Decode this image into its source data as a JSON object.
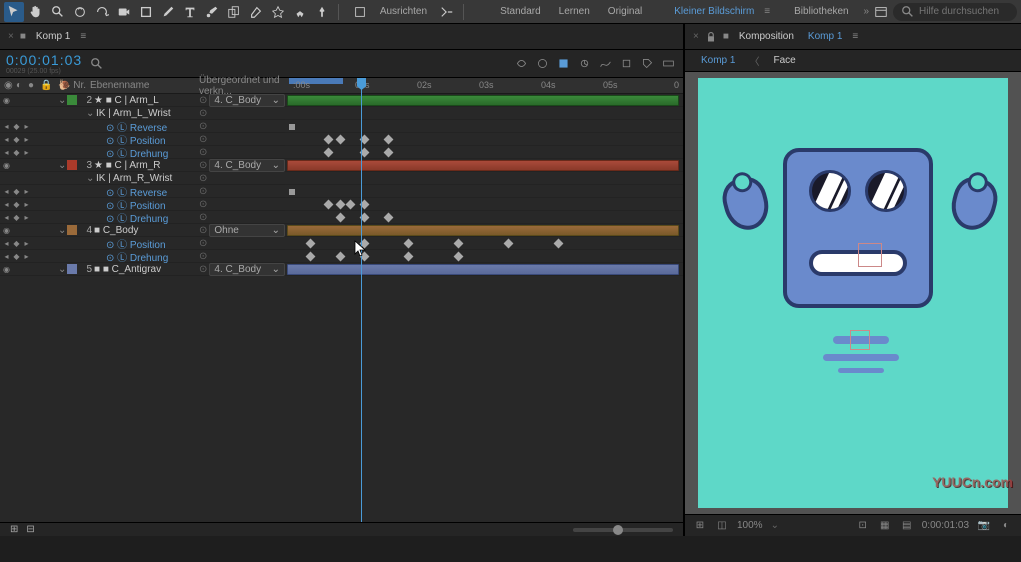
{
  "toolbar": {
    "align_label": "Ausrichten",
    "tabs": [
      "Standard",
      "Lernen",
      "Original"
    ],
    "workspace": "Kleiner Bildschirm",
    "libraries": "Bibliotheken",
    "search_placeholder": "Hilfe durchsuchen"
  },
  "tabbar": {
    "left_tab": "Komp 1",
    "right_prefix": "Komposition",
    "right_tab": "Komp 1"
  },
  "timeline": {
    "timecode": "0:00:01:03",
    "subinfo": "00029 (25.00 fps)",
    "col_nr": "Nr.",
    "col_name": "Ebenenname",
    "col_parent": "Übergeordnet und verkn...",
    "ruler": [
      ":00s",
      "01s",
      "02s",
      "03s",
      "04s",
      "05s"
    ],
    "end_label": "0"
  },
  "layers": [
    {
      "nr": "2",
      "name": "★ ■ C | Arm_L",
      "parent": "4. C_Body",
      "color": "#3a8a3a",
      "type": "layer"
    },
    {
      "name": "IK | Arm_L_Wrist",
      "type": "group",
      "indent": 1
    },
    {
      "name": "Reverse",
      "type": "prop",
      "indent": 2,
      "stop": true
    },
    {
      "name": "Position",
      "type": "prop",
      "indent": 2,
      "stop": true
    },
    {
      "name": "Drehung",
      "type": "prop",
      "indent": 2,
      "stop": true
    },
    {
      "nr": "3",
      "name": "★ ■ C | Arm_R",
      "parent": "4. C_Body",
      "color": "#aa3a2a",
      "type": "layer"
    },
    {
      "name": "IK | Arm_R_Wrist",
      "type": "group",
      "indent": 1
    },
    {
      "name": "Reverse",
      "type": "prop",
      "indent": 2,
      "stop": true
    },
    {
      "name": "Position",
      "type": "prop",
      "indent": 2,
      "stop": true
    },
    {
      "name": "Drehung",
      "type": "prop",
      "indent": 2,
      "stop": true
    },
    {
      "nr": "4",
      "name": "■ C_Body",
      "parent": "Ohne",
      "color": "#9a6a3a",
      "type": "layer"
    },
    {
      "name": "Position",
      "type": "prop",
      "indent": 2,
      "stop": true
    },
    {
      "name": "Drehung",
      "type": "prop",
      "indent": 2,
      "stop": true
    },
    {
      "nr": "5",
      "name": "■ ■ C_Antigrav",
      "parent": "4. C_Body",
      "color": "#6a7aaa",
      "type": "layer"
    }
  ],
  "comp_tabs": {
    "main": "Komp 1",
    "crumb": "Face"
  },
  "viewer_footer": {
    "zoom": "100%",
    "timecode": "0:00:01:03"
  },
  "watermark": "YUUCn.com"
}
